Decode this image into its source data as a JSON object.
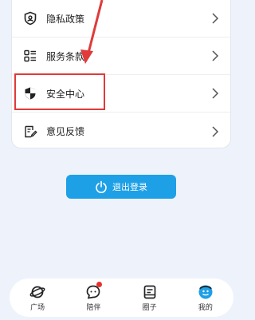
{
  "menu": {
    "items": [
      {
        "label": "隐私政策",
        "icon": "shield-user-icon"
      },
      {
        "label": "服务条款",
        "icon": "list-icon"
      },
      {
        "label": "安全中心",
        "icon": "security-shield-icon"
      },
      {
        "label": "意见反馈",
        "icon": "feedback-icon"
      }
    ]
  },
  "logout": {
    "label": "退出登录",
    "icon": "power-icon"
  },
  "tabbar": {
    "items": [
      {
        "label": "广场",
        "icon": "planet-icon"
      },
      {
        "label": "陪伴",
        "icon": "chat-bubble-icon",
        "badge": true
      },
      {
        "label": "圈子",
        "icon": "notebook-icon"
      },
      {
        "label": "我的",
        "icon": "profile-icon",
        "active": true
      }
    ]
  },
  "colors": {
    "accent": "#1ea0e6",
    "annotation": "#e03a3a",
    "background": "#eef3fb"
  }
}
